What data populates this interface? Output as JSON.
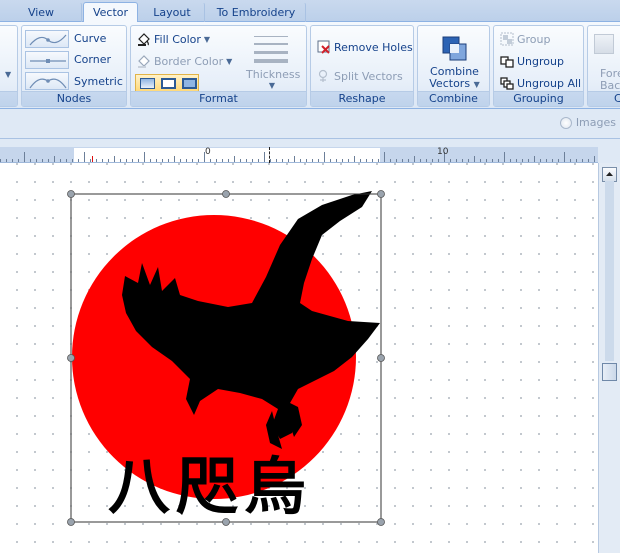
{
  "tabs": [
    {
      "label": "View",
      "active": false
    },
    {
      "label": "Vector",
      "active": true
    },
    {
      "label": "Layout",
      "active": false
    },
    {
      "label": "To Embroidery",
      "active": false
    }
  ],
  "ribbon": {
    "nodes": {
      "label": "Nodes",
      "curve": "Curve",
      "corner": "Corner",
      "symetric": "Symetric"
    },
    "format": {
      "label": "Format",
      "fill_color": "Fill Color",
      "border_color": "Border Color",
      "thickness": "Thickness"
    },
    "reshape": {
      "label": "Reshape",
      "remove_holes": "Remove Holes",
      "split_vectors": "Split Vectors"
    },
    "combine": {
      "label": "Combine",
      "combine_vectors_line1": "Combine",
      "combine_vectors_line2": "Vectors"
    },
    "grouping": {
      "label": "Grouping",
      "group": "Group",
      "ungroup": "Ungroup",
      "ungroup_all": "Ungroup All"
    },
    "arrange": {
      "fore_line1": "Fore",
      "fore_line2": "Back",
      "partial_label": "C"
    }
  },
  "options": {
    "images_label": "Images"
  },
  "ruler": {
    "label_0": "0",
    "label_10": "10"
  },
  "artwork": {
    "text": "八咫烏",
    "sun_color": "#ff0000",
    "crow_color": "#000000"
  },
  "colors": {
    "ribbon_text": "#15428b",
    "tab_active_bg": "#f4f8fd",
    "accent_border": "#8db2e3"
  }
}
